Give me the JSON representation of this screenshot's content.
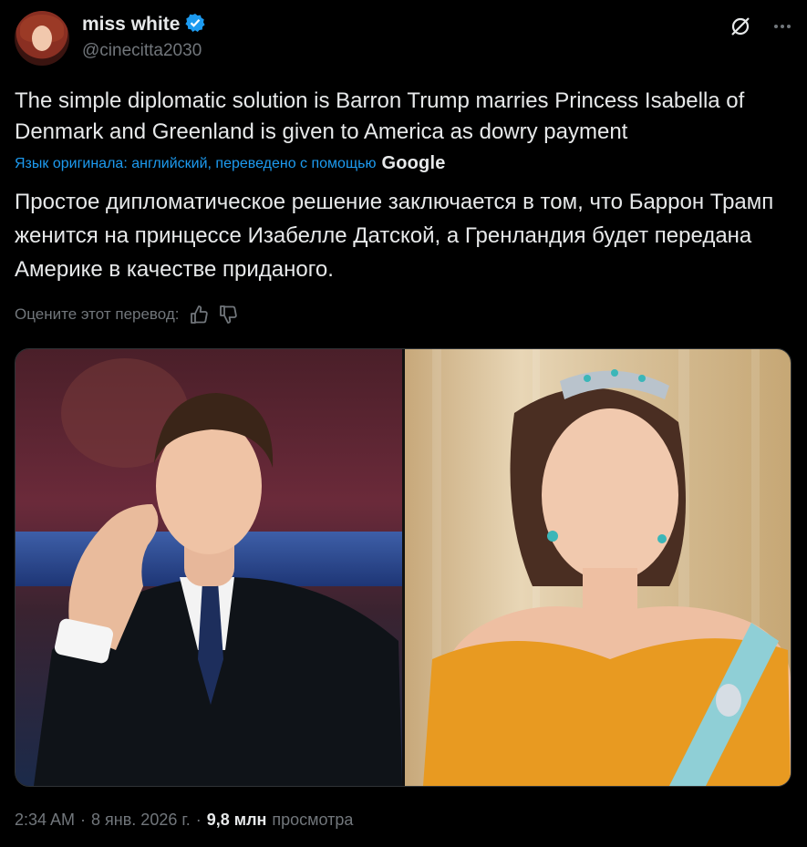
{
  "author": {
    "display_name": "miss white",
    "handle": "@cinecitta2030",
    "verified": true,
    "verified_color": "#1d9bf0"
  },
  "header_icons": [
    "grok-icon",
    "more-icon"
  ],
  "tweet": {
    "original_text": "The simple diplomatic solution is Barron Trump marries Princess Isabella of Denmark and Greenland is given to America as dowry payment",
    "translation_note": "Язык оригинала: английский, переведено с помощью",
    "translation_provider": "Google",
    "translated_text": "Простое дипломатическое решение заключается в том, что Баррон Трамп женится на принцессе Изабелле Датской, а Гренландия будет передана Америке в качестве приданого.",
    "rate_prompt": "Оцените этот перевод:"
  },
  "media": {
    "count": 2,
    "items": [
      "photo",
      "photo"
    ]
  },
  "meta": {
    "time": "2:34 AM",
    "separator": "·",
    "date": "8 янв. 2026 г.",
    "views_count": "9,8 млн",
    "views_label": "просмотра"
  },
  "colors": {
    "background": "#000000",
    "text": "#e7e9ea",
    "muted": "#71767b",
    "accent": "#1d9bf0"
  }
}
